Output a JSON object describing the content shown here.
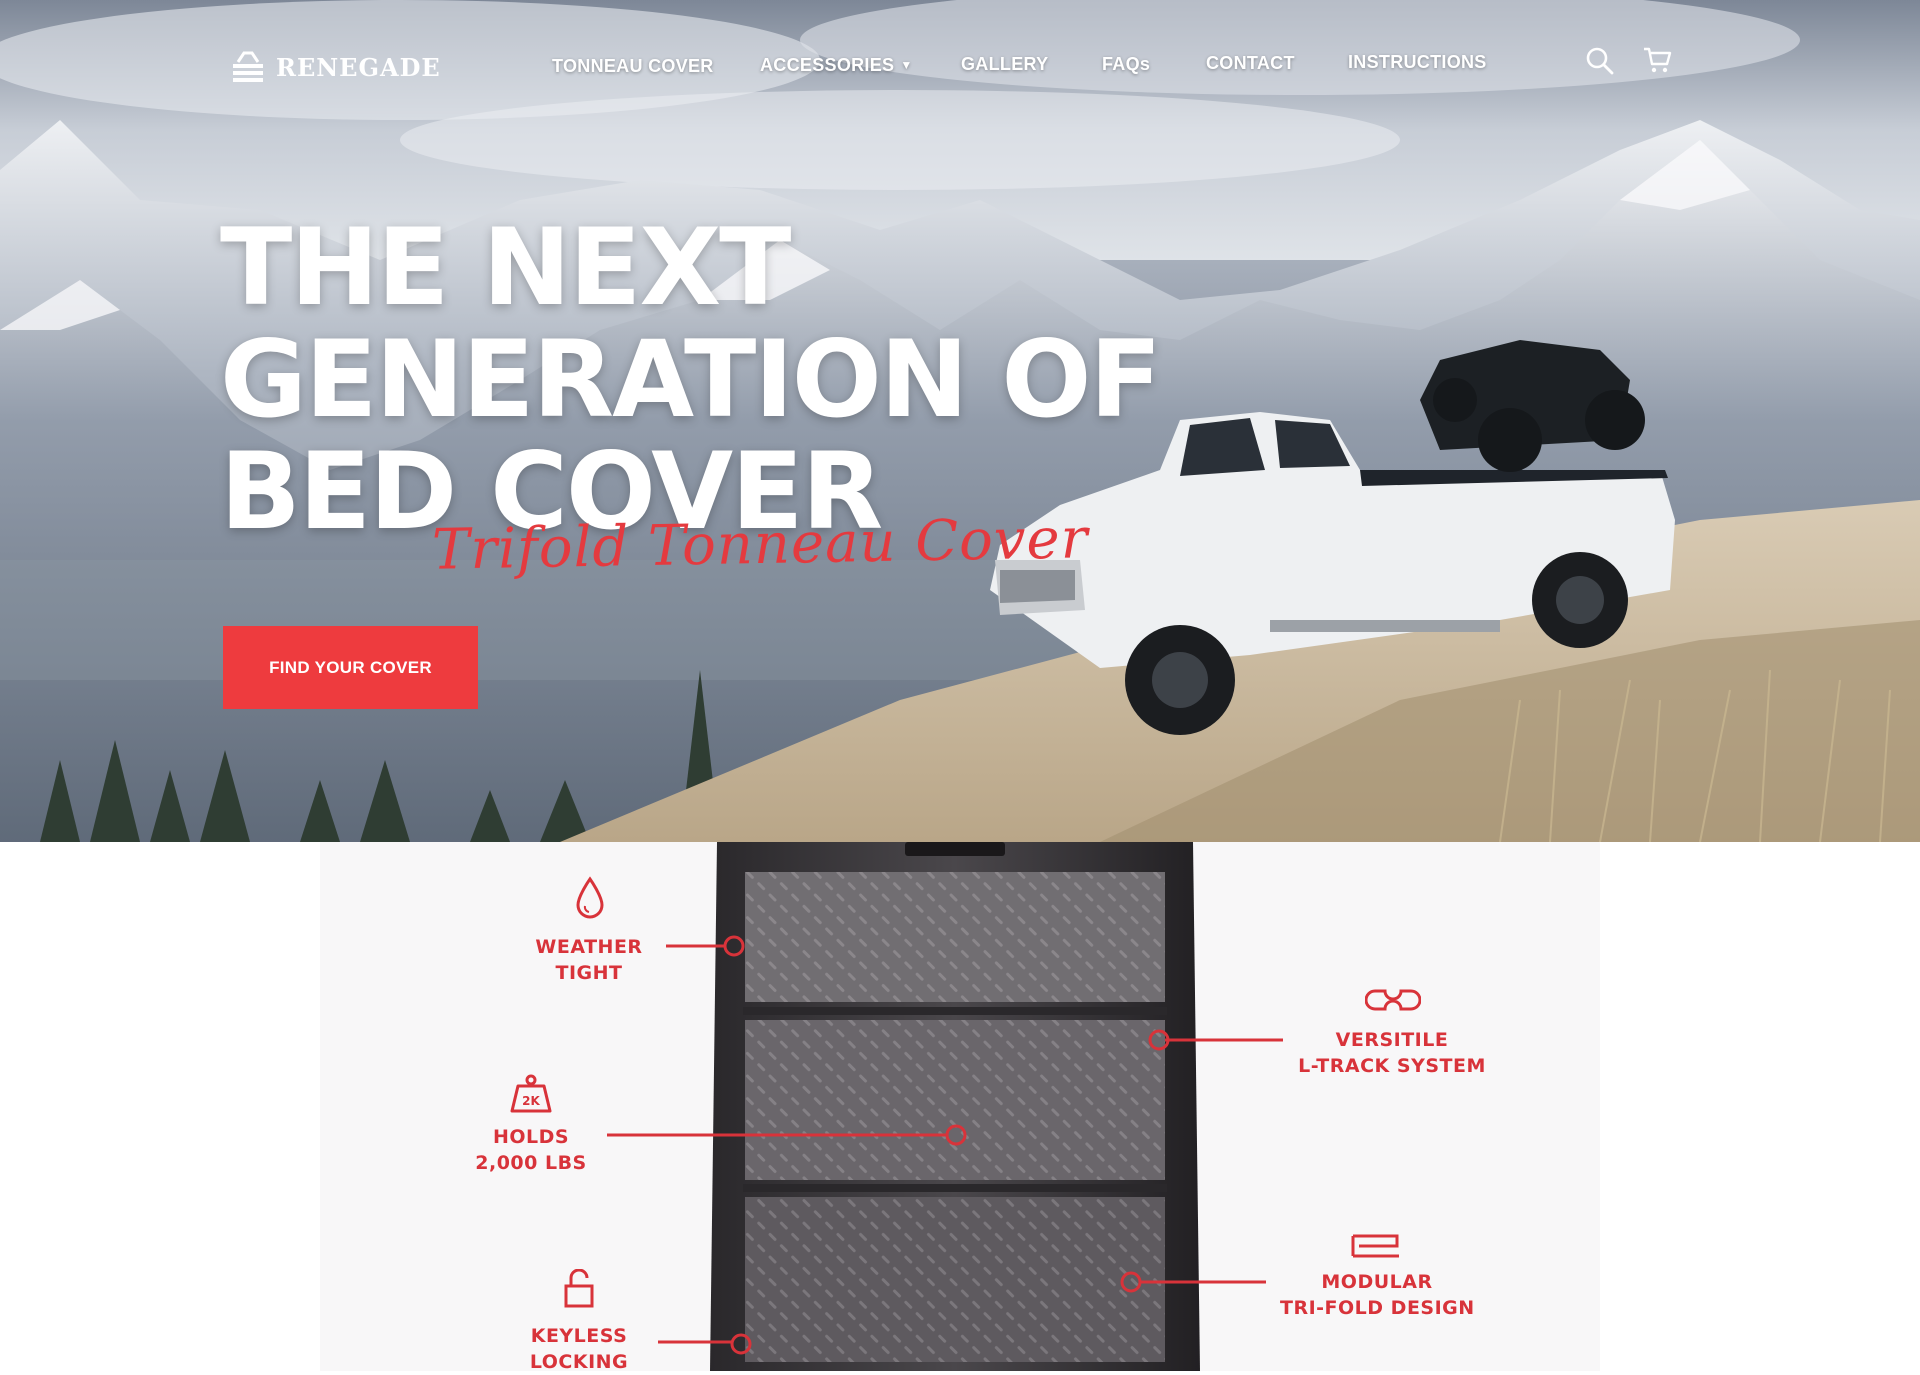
{
  "brand": {
    "name": "RENEGADE"
  },
  "nav": {
    "items": [
      {
        "label": "TONNEAU COVER"
      },
      {
        "label": "ACCESSORIES",
        "has_dropdown": true
      },
      {
        "label": "GALLERY"
      },
      {
        "label": "FAQs"
      },
      {
        "label": "CONTACT"
      },
      {
        "label": "INSTRUCTIONS"
      }
    ],
    "icons": [
      "search-icon",
      "cart-icon"
    ]
  },
  "hero": {
    "headline_lines": [
      "THE NEXT",
      "GENERATION OF",
      "BED COVER"
    ],
    "script_text": "Trifold Tonneau Cover",
    "cta_label": "FIND YOUR COVER"
  },
  "features": [
    {
      "icon": "water-drop-icon",
      "lines": [
        "WEATHER",
        "TIGHT"
      ]
    },
    {
      "icon": "weight-2k-icon",
      "icon_text": "2K",
      "lines": [
        "HOLDS",
        "2,000 LBS"
      ]
    },
    {
      "icon": "padlock-icon",
      "lines": [
        "KEYLESS",
        "LOCKING"
      ]
    },
    {
      "icon": "l-track-icon",
      "lines": [
        "VERSITILE",
        "L-TRACK SYSTEM"
      ]
    },
    {
      "icon": "trifold-icon",
      "lines": [
        "MODULAR",
        "TRI-FOLD DESIGN"
      ]
    }
  ],
  "colors": {
    "accent": "#ee3b3e",
    "feature_red": "#d8333a",
    "text_light": "#ffffff"
  }
}
